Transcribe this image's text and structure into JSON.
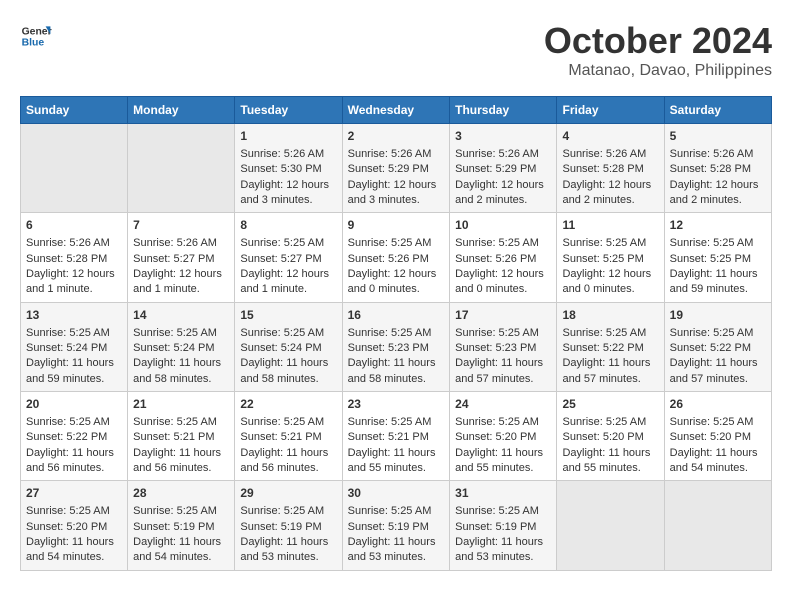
{
  "header": {
    "logo_line1": "General",
    "logo_line2": "Blue",
    "month": "October 2024",
    "location": "Matanao, Davao, Philippines"
  },
  "days_of_week": [
    "Sunday",
    "Monday",
    "Tuesday",
    "Wednesday",
    "Thursday",
    "Friday",
    "Saturday"
  ],
  "weeks": [
    [
      {
        "day": "",
        "sunrise": "",
        "sunset": "",
        "daylight": ""
      },
      {
        "day": "",
        "sunrise": "",
        "sunset": "",
        "daylight": ""
      },
      {
        "day": "1",
        "sunrise": "Sunrise: 5:26 AM",
        "sunset": "Sunset: 5:30 PM",
        "daylight": "Daylight: 12 hours and 3 minutes."
      },
      {
        "day": "2",
        "sunrise": "Sunrise: 5:26 AM",
        "sunset": "Sunset: 5:29 PM",
        "daylight": "Daylight: 12 hours and 3 minutes."
      },
      {
        "day": "3",
        "sunrise": "Sunrise: 5:26 AM",
        "sunset": "Sunset: 5:29 PM",
        "daylight": "Daylight: 12 hours and 2 minutes."
      },
      {
        "day": "4",
        "sunrise": "Sunrise: 5:26 AM",
        "sunset": "Sunset: 5:28 PM",
        "daylight": "Daylight: 12 hours and 2 minutes."
      },
      {
        "day": "5",
        "sunrise": "Sunrise: 5:26 AM",
        "sunset": "Sunset: 5:28 PM",
        "daylight": "Daylight: 12 hours and 2 minutes."
      }
    ],
    [
      {
        "day": "6",
        "sunrise": "Sunrise: 5:26 AM",
        "sunset": "Sunset: 5:28 PM",
        "daylight": "Daylight: 12 hours and 1 minute."
      },
      {
        "day": "7",
        "sunrise": "Sunrise: 5:26 AM",
        "sunset": "Sunset: 5:27 PM",
        "daylight": "Daylight: 12 hours and 1 minute."
      },
      {
        "day": "8",
        "sunrise": "Sunrise: 5:25 AM",
        "sunset": "Sunset: 5:27 PM",
        "daylight": "Daylight: 12 hours and 1 minute."
      },
      {
        "day": "9",
        "sunrise": "Sunrise: 5:25 AM",
        "sunset": "Sunset: 5:26 PM",
        "daylight": "Daylight: 12 hours and 0 minutes."
      },
      {
        "day": "10",
        "sunrise": "Sunrise: 5:25 AM",
        "sunset": "Sunset: 5:26 PM",
        "daylight": "Daylight: 12 hours and 0 minutes."
      },
      {
        "day": "11",
        "sunrise": "Sunrise: 5:25 AM",
        "sunset": "Sunset: 5:25 PM",
        "daylight": "Daylight: 12 hours and 0 minutes."
      },
      {
        "day": "12",
        "sunrise": "Sunrise: 5:25 AM",
        "sunset": "Sunset: 5:25 PM",
        "daylight": "Daylight: 11 hours and 59 minutes."
      }
    ],
    [
      {
        "day": "13",
        "sunrise": "Sunrise: 5:25 AM",
        "sunset": "Sunset: 5:24 PM",
        "daylight": "Daylight: 11 hours and 59 minutes."
      },
      {
        "day": "14",
        "sunrise": "Sunrise: 5:25 AM",
        "sunset": "Sunset: 5:24 PM",
        "daylight": "Daylight: 11 hours and 58 minutes."
      },
      {
        "day": "15",
        "sunrise": "Sunrise: 5:25 AM",
        "sunset": "Sunset: 5:24 PM",
        "daylight": "Daylight: 11 hours and 58 minutes."
      },
      {
        "day": "16",
        "sunrise": "Sunrise: 5:25 AM",
        "sunset": "Sunset: 5:23 PM",
        "daylight": "Daylight: 11 hours and 58 minutes."
      },
      {
        "day": "17",
        "sunrise": "Sunrise: 5:25 AM",
        "sunset": "Sunset: 5:23 PM",
        "daylight": "Daylight: 11 hours and 57 minutes."
      },
      {
        "day": "18",
        "sunrise": "Sunrise: 5:25 AM",
        "sunset": "Sunset: 5:22 PM",
        "daylight": "Daylight: 11 hours and 57 minutes."
      },
      {
        "day": "19",
        "sunrise": "Sunrise: 5:25 AM",
        "sunset": "Sunset: 5:22 PM",
        "daylight": "Daylight: 11 hours and 57 minutes."
      }
    ],
    [
      {
        "day": "20",
        "sunrise": "Sunrise: 5:25 AM",
        "sunset": "Sunset: 5:22 PM",
        "daylight": "Daylight: 11 hours and 56 minutes."
      },
      {
        "day": "21",
        "sunrise": "Sunrise: 5:25 AM",
        "sunset": "Sunset: 5:21 PM",
        "daylight": "Daylight: 11 hours and 56 minutes."
      },
      {
        "day": "22",
        "sunrise": "Sunrise: 5:25 AM",
        "sunset": "Sunset: 5:21 PM",
        "daylight": "Daylight: 11 hours and 56 minutes."
      },
      {
        "day": "23",
        "sunrise": "Sunrise: 5:25 AM",
        "sunset": "Sunset: 5:21 PM",
        "daylight": "Daylight: 11 hours and 55 minutes."
      },
      {
        "day": "24",
        "sunrise": "Sunrise: 5:25 AM",
        "sunset": "Sunset: 5:20 PM",
        "daylight": "Daylight: 11 hours and 55 minutes."
      },
      {
        "day": "25",
        "sunrise": "Sunrise: 5:25 AM",
        "sunset": "Sunset: 5:20 PM",
        "daylight": "Daylight: 11 hours and 55 minutes."
      },
      {
        "day": "26",
        "sunrise": "Sunrise: 5:25 AM",
        "sunset": "Sunset: 5:20 PM",
        "daylight": "Daylight: 11 hours and 54 minutes."
      }
    ],
    [
      {
        "day": "27",
        "sunrise": "Sunrise: 5:25 AM",
        "sunset": "Sunset: 5:20 PM",
        "daylight": "Daylight: 11 hours and 54 minutes."
      },
      {
        "day": "28",
        "sunrise": "Sunrise: 5:25 AM",
        "sunset": "Sunset: 5:19 PM",
        "daylight": "Daylight: 11 hours and 54 minutes."
      },
      {
        "day": "29",
        "sunrise": "Sunrise: 5:25 AM",
        "sunset": "Sunset: 5:19 PM",
        "daylight": "Daylight: 11 hours and 53 minutes."
      },
      {
        "day": "30",
        "sunrise": "Sunrise: 5:25 AM",
        "sunset": "Sunset: 5:19 PM",
        "daylight": "Daylight: 11 hours and 53 minutes."
      },
      {
        "day": "31",
        "sunrise": "Sunrise: 5:25 AM",
        "sunset": "Sunset: 5:19 PM",
        "daylight": "Daylight: 11 hours and 53 minutes."
      },
      {
        "day": "",
        "sunrise": "",
        "sunset": "",
        "daylight": ""
      },
      {
        "day": "",
        "sunrise": "",
        "sunset": "",
        "daylight": ""
      }
    ]
  ]
}
